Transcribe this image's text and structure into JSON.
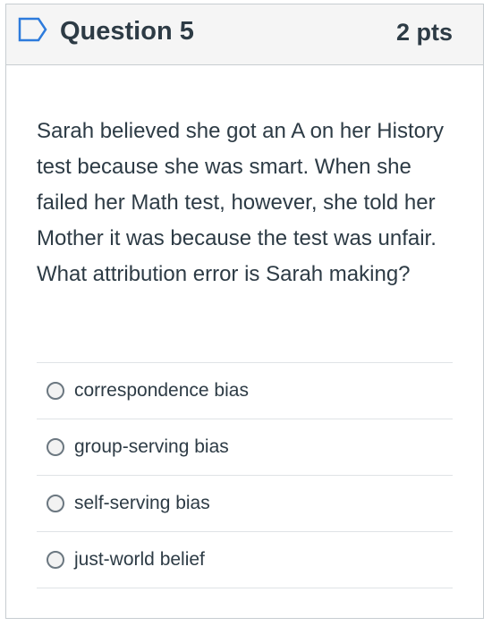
{
  "question": {
    "icon": "flag-outline-icon",
    "title": "Question 5",
    "points": "2 pts",
    "text": "Sarah believed she got an A on her History test because she was smart. When she failed her Math test, however, she told her Mother it was because the test was unfair. What attribution error is Sarah making?"
  },
  "answers": [
    {
      "label": "correspondence bias"
    },
    {
      "label": "group-serving bias"
    },
    {
      "label": "self-serving bias"
    },
    {
      "label": "just-world belief"
    }
  ],
  "colors": {
    "accent": "#2d7bdc",
    "text": "#2d3b45",
    "border": "#c7cdd1",
    "header_bg": "#f5f5f5"
  }
}
